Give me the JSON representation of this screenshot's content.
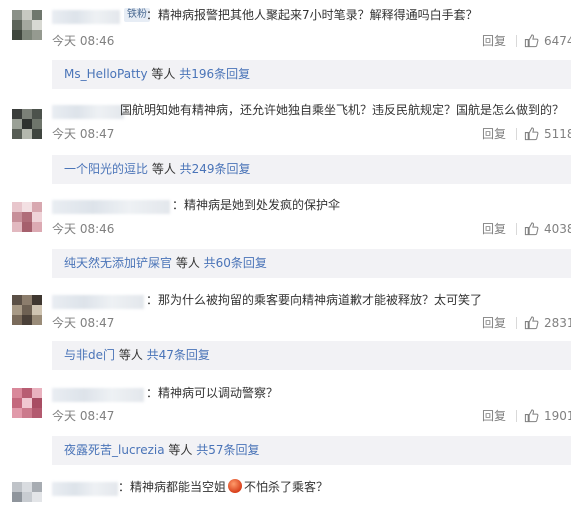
{
  "colors": {
    "link": "#4a74b8",
    "muted": "#808080",
    "subbox_bg": "#f2f2f5"
  },
  "comments": [
    {
      "badge": "铁粉",
      "text": "精神病报警把其他人聚起来7小时笔录？解释得通吗白手套？",
      "time": "今天 08:46",
      "reply": "回复",
      "likes": "6474",
      "sub": {
        "user": "Ms_HelloPatty",
        "mid": " 等人 ",
        "count": "共196条回复"
      }
    },
    {
      "text": "国航明知她有精神病，还允许她独自乘坐飞机？违反民航规定？国航是怎么做到的？",
      "time": "今天 08:47",
      "reply": "回复",
      "likes": "5118",
      "sub": {
        "user": "一个阳光的逗比",
        "mid": " 等人 ",
        "count": "共249条回复"
      }
    },
    {
      "text": "精神病是她到处发疯的保护伞",
      "time": "今天 08:46",
      "reply": "回复",
      "likes": "4038",
      "sub": {
        "user": "纯天然无添加铲屎官",
        "mid": " 等人 ",
        "count": "共60条回复"
      }
    },
    {
      "text": "那为什么被拘留的乘客要向精神病道歉才能被释放？太可笑了",
      "time": "今天 08:47",
      "reply": "回复",
      "likes": "2831",
      "sub": {
        "user": "与非de门",
        "mid": " 等人 ",
        "count": "共47条回复"
      }
    },
    {
      "text": "精神病可以调动警察？",
      "time": "今天 08:47",
      "reply": "回复",
      "likes": "1901",
      "sub": {
        "user": "夜露死苦_lucrezia",
        "mid": " 等人 ",
        "count": "共57条回复"
      }
    },
    {
      "text_a": "精神病都能当空姐",
      "text_b": "不怕杀了乘客？"
    }
  ]
}
